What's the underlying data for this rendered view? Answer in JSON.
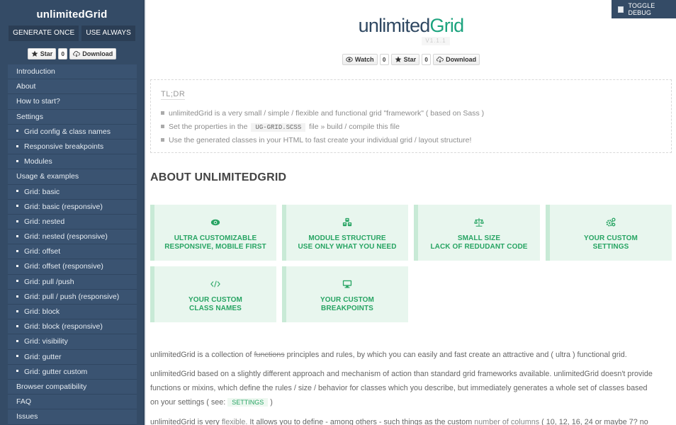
{
  "sidebar": {
    "title": "unlimitedGrid",
    "buttons": [
      "GENERATE ONCE",
      "USE ALWAYS"
    ],
    "github": {
      "star_label": "Star",
      "star_count": "0",
      "download_label": "Download"
    },
    "nav": [
      {
        "label": "Introduction",
        "sub": false
      },
      {
        "label": "About",
        "sub": false
      },
      {
        "label": "How to start?",
        "sub": false
      },
      {
        "label": "Settings",
        "sub": false
      },
      {
        "label": "Grid config & class names",
        "sub": true
      },
      {
        "label": "Responsive breakpoints",
        "sub": true
      },
      {
        "label": "Modules",
        "sub": true
      },
      {
        "label": "Usage & examples",
        "sub": false
      },
      {
        "label": "Grid: basic",
        "sub": true
      },
      {
        "label": "Grid: basic (responsive)",
        "sub": true
      },
      {
        "label": "Grid: nested",
        "sub": true
      },
      {
        "label": "Grid: nested (responsive)",
        "sub": true
      },
      {
        "label": "Grid: offset",
        "sub": true
      },
      {
        "label": "Grid: offset (responsive)",
        "sub": true
      },
      {
        "label": "Grid: pull /push",
        "sub": true
      },
      {
        "label": "Grid: pull / push (responsive)",
        "sub": true
      },
      {
        "label": "Grid: block",
        "sub": true
      },
      {
        "label": "Grid: block (responsive)",
        "sub": true
      },
      {
        "label": "Grid: visibility",
        "sub": true
      },
      {
        "label": "Grid: gutter",
        "sub": true
      },
      {
        "label": "Grid: gutter custom",
        "sub": true
      },
      {
        "label": "Browser compatibility",
        "sub": false
      },
      {
        "label": "FAQ",
        "sub": false
      },
      {
        "label": "Issues",
        "sub": false
      }
    ]
  },
  "toggle_debug": {
    "label": "TOGGLE DEBUG"
  },
  "header": {
    "logo_part1": "unlimited",
    "logo_part2": "Grid",
    "version": "V1.1.1",
    "github": {
      "watch_label": "Watch",
      "watch_count": "0",
      "star_label": "Star",
      "star_count": "0",
      "download_label": "Download"
    }
  },
  "tldr": {
    "title": "TL;DR",
    "items": [
      {
        "text": "unlimitedGrid is a very small / simple / flexible and functional grid \"framework\" ( based on Sass )"
      },
      {
        "pre": "Set the properties in the",
        "code": "UG-GRID.SCSS",
        "post": "file » build / compile this file"
      },
      {
        "text": "Use the generated classes in your HTML to fast create your individual grid / layout structure!"
      }
    ]
  },
  "about": {
    "heading": "ABOUT UNLIMITEDGRID",
    "accent_color": "#27a463",
    "cards": [
      {
        "icon": "eye-icon",
        "line1": "ULTRA CUSTOMIZABLE",
        "line2": "RESPONSIVE, MOBILE FIRST"
      },
      {
        "icon": "cubes-icon",
        "line1": "MODULE STRUCTURE",
        "line2": "USE ONLY WHAT YOU NEED"
      },
      {
        "icon": "balance-scale-icon",
        "line1": "SMALL SIZE",
        "line2": "LACK OF REDUDANT CODE"
      },
      {
        "icon": "gears-icon",
        "line1": "YOUR CUSTOM",
        "line2": "SETTINGS"
      },
      {
        "icon": "code-icon",
        "line1": "YOUR CUSTOM",
        "line2": "CLASS NAMES"
      },
      {
        "icon": "desktop-icon",
        "line1": "YOUR CUSTOM",
        "line2": "BREAKPOINTS"
      }
    ]
  },
  "body": {
    "p1_pre": "unlimitedGrid is a collection of",
    "p1_strike": "functions",
    "p1_post": "principles and rules, by which you can easily and fast create an attractive and ( ultra ) functional grid.",
    "p2_line1": "unlimitedGrid based on a slightly different approach and mechanism of action than standard grid frameworks available. unlimitedGrid doesn't provide",
    "p2_line2": "functions or mixins, which define the rules / size / behavior for classes which you describe, but immediately generates a whole set of classes based",
    "p2_line3_pre": "on your settings ( see:",
    "p2_tag": "SETTINGS",
    "p2_line3_post": ")",
    "p3_pre": "unlimitedGrid is very",
    "p3_flex": "flexible.",
    "p3_mid": "It allows you to define - among others - such things as the custom",
    "p3_link": "number of columns",
    "p3_post": "( 10, 12, 16, 24 or maybe 7? no"
  }
}
